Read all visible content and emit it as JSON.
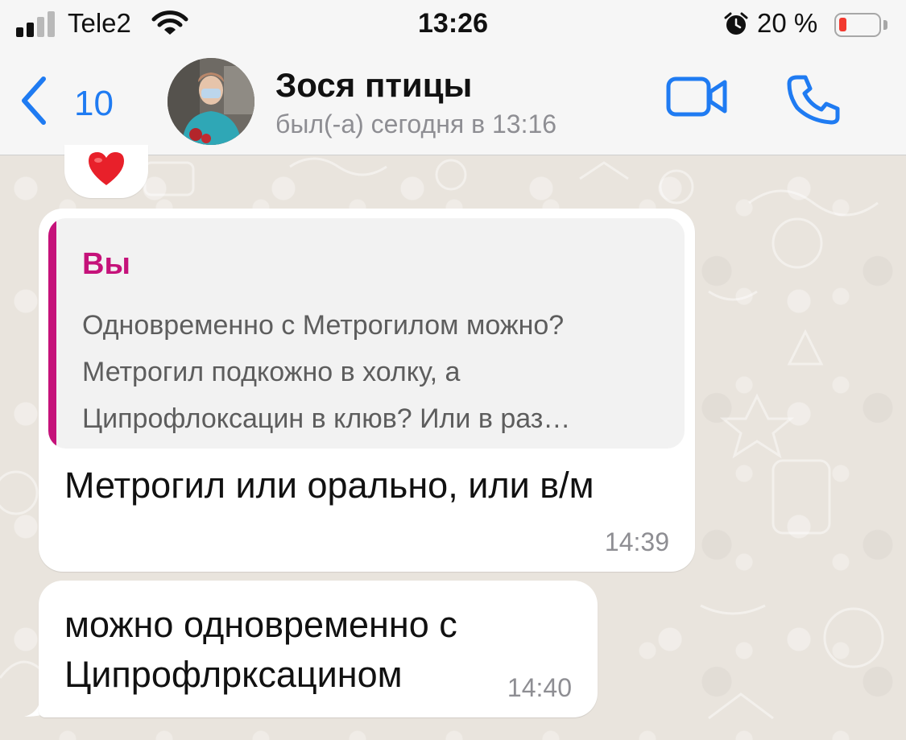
{
  "status_bar": {
    "carrier": "Tele2",
    "time": "13:26",
    "battery_percent": "20 %",
    "battery_level": 0.2,
    "signal_bars_active": 2,
    "signal_bars_total": 4
  },
  "header": {
    "back_count": "10",
    "contact_name": "Зося птицы",
    "last_seen": "был(-а) сегодня в 13:16"
  },
  "messages": [
    {
      "type": "received",
      "quote": {
        "author": "Вы",
        "text": "Одновременно с Метрогилом можно? Метрогил подкожно в холку, а Ципрофлоксацин в клюв? Или в раз…"
      },
      "text": "Метрогил или орально, или в/м",
      "time": "14:39"
    },
    {
      "type": "received",
      "text": "можно одновременно с Ципрофлрксацином",
      "time": "14:40"
    }
  ],
  "colors": {
    "accent": "#1f7bf2",
    "quote_accent": "#c5127a",
    "battery_low": "#f23a30"
  },
  "icons": [
    "signal-icon",
    "wifi-icon",
    "alarm-icon",
    "battery-icon",
    "chevron-left-icon",
    "video-camera-icon",
    "phone-icon",
    "heart-icon"
  ]
}
